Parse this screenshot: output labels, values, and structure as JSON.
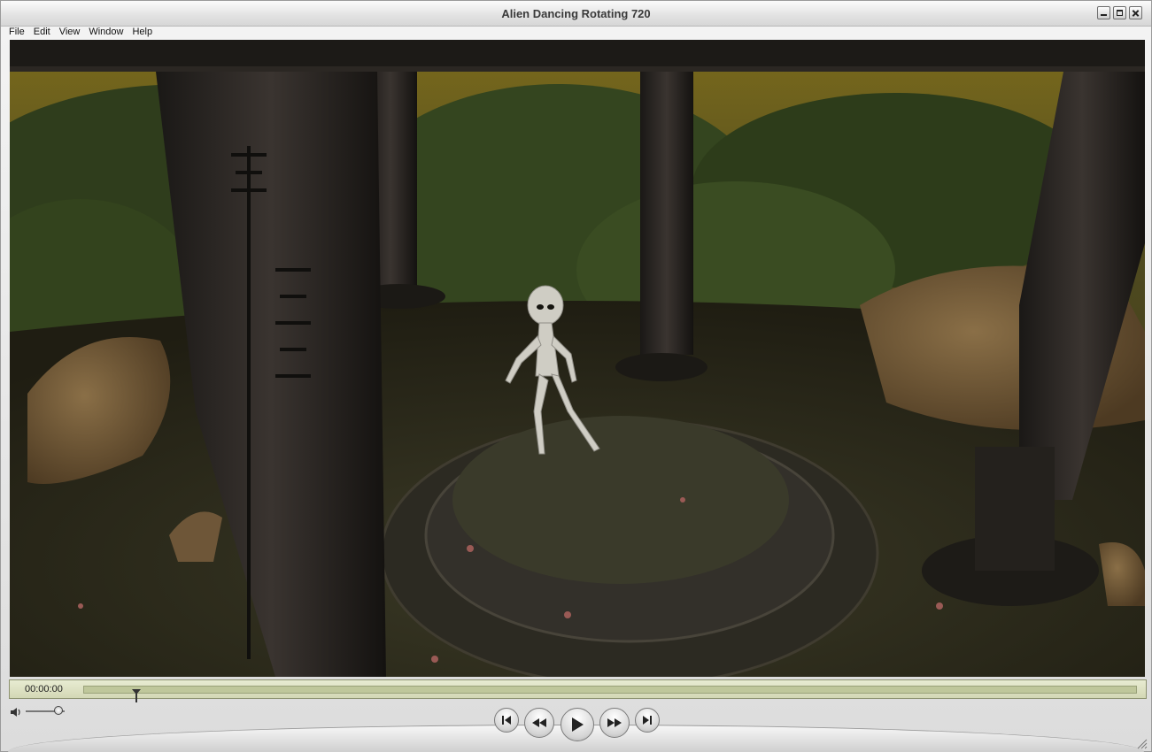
{
  "window": {
    "title": "Alien Dancing Rotating 720"
  },
  "menu": {
    "items": [
      "File",
      "Edit",
      "View",
      "Window",
      "Help"
    ]
  },
  "player": {
    "timecode": "00:00:00",
    "playhead_fraction": 0.05,
    "volume_fraction": 0.85
  },
  "icons": {
    "minimize": "minimize-icon",
    "maximize": "maximize-icon",
    "close": "close-icon",
    "volume": "speaker-icon",
    "go_to_start": "skip-back-icon",
    "rewind": "rewind-icon",
    "play": "play-icon",
    "fast_forward": "fast-forward-icon",
    "go_to_end": "skip-forward-icon"
  }
}
